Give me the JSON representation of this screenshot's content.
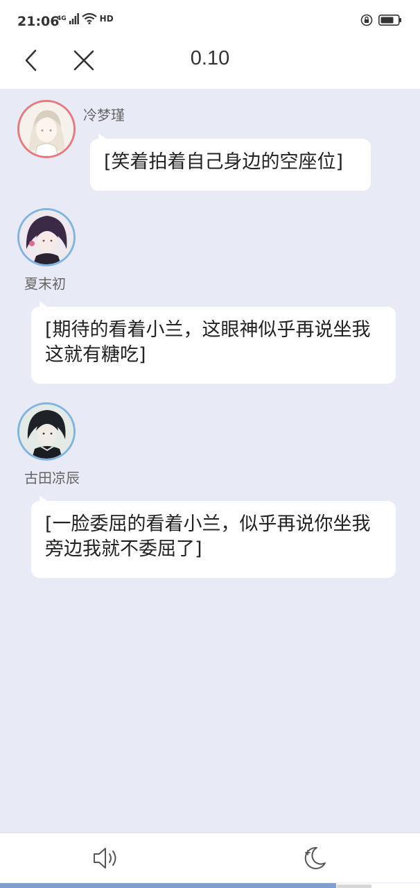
{
  "status_bar": {
    "time": "21:06",
    "network": "4G",
    "hd": "HD"
  },
  "header": {
    "title": "0.10"
  },
  "messages": [
    {
      "speaker": "冷梦瑾",
      "text": "[笑着拍着自己身边的空座位]",
      "avatar_border": "#e67a80"
    },
    {
      "speaker": "夏末初",
      "text": "[期待的看着小兰，这眼神似乎再说坐我这就有糖吃]",
      "avatar_border": "#7fb5e0"
    },
    {
      "speaker": "古田凉辰",
      "text": "[一脸委屈的看着小兰，似乎再说你坐我旁边我就不委屈了]",
      "avatar_border": "#7fb5e0"
    }
  ],
  "progress": {
    "value": 0.8
  },
  "colors": {
    "chat_background": "#e8eaf6",
    "bubble": "#ffffff",
    "progress": "#7f9fd0"
  }
}
